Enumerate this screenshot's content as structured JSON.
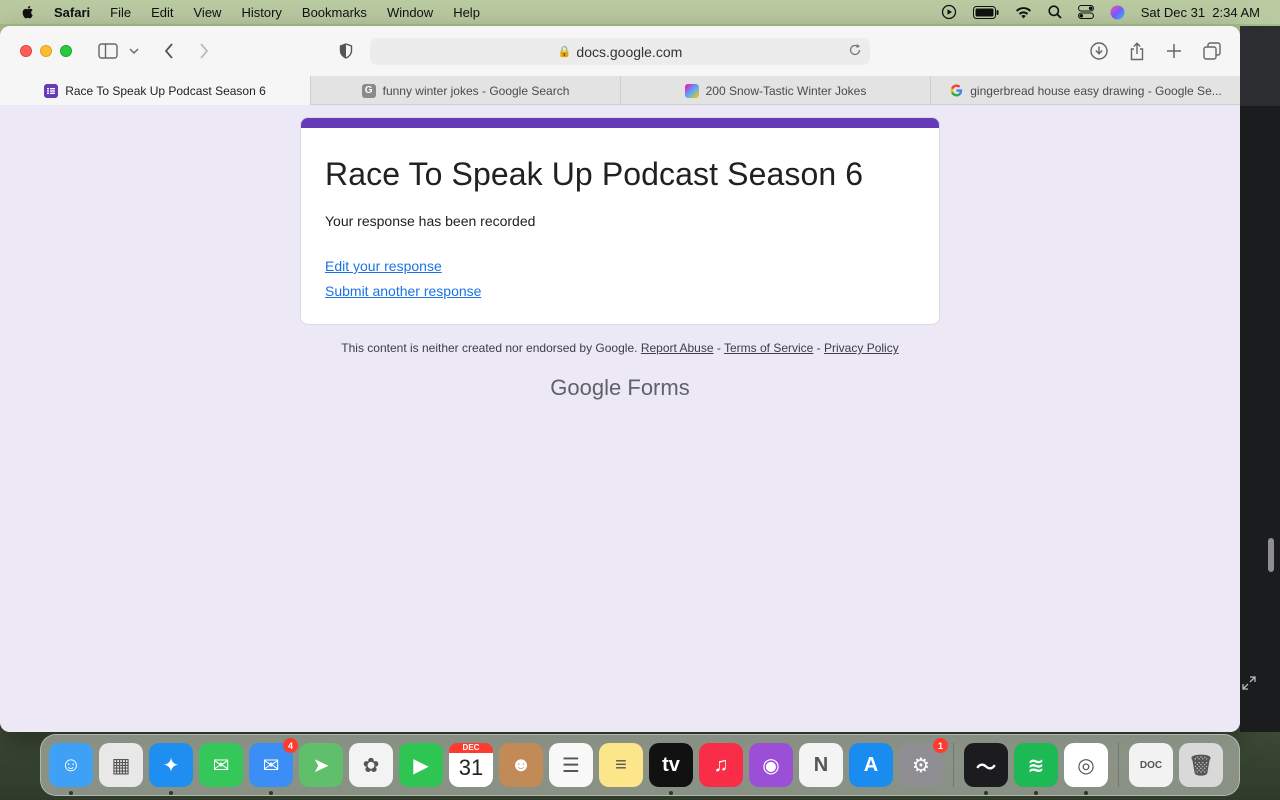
{
  "menubar": {
    "app_name": "Safari",
    "items": [
      "File",
      "Edit",
      "View",
      "History",
      "Bookmarks",
      "Window",
      "Help"
    ],
    "clock": "Sat Dec 31  2:34 AM"
  },
  "toolbar": {
    "url": "docs.google.com"
  },
  "tabs": [
    {
      "label": "Race To Speak Up Podcast Season 6",
      "favicon": "google-forms-icon",
      "active": true
    },
    {
      "label": "funny winter jokes - Google Search",
      "favicon": "google-g-icon",
      "active": false
    },
    {
      "label": "200 Snow-Tastic Winter Jokes",
      "favicon": "site-icon",
      "active": false
    },
    {
      "label": "gingerbread house easy drawing - Google Se...",
      "favicon": "google-g-icon",
      "active": false
    }
  ],
  "form": {
    "title": "Race To Speak Up Podcast Season 6",
    "message": "Your response has been recorded",
    "edit_link": "Edit your response",
    "another_link": "Submit another response",
    "accent_color": "#673ab7"
  },
  "footer": {
    "disclaimer": "This content is neither created nor endorsed by Google.",
    "report_abuse": "Report Abuse",
    "terms": "Terms of Service",
    "privacy": "Privacy Policy",
    "separator": " - ",
    "brand_google": "Google",
    "brand_forms": "Forms"
  },
  "dock": {
    "items": [
      {
        "name": "finder",
        "color": "#3ea1f5",
        "glyph": "☺",
        "running": true
      },
      {
        "name": "launchpad",
        "color": "#e8e8e8",
        "glyph": "▦",
        "running": false
      },
      {
        "name": "safari",
        "color": "#1e8ef0",
        "glyph": "✦",
        "running": true
      },
      {
        "name": "messages",
        "color": "#34c759",
        "glyph": "✉",
        "running": false
      },
      {
        "name": "mail",
        "color": "#3a8ef6",
        "glyph": "✉",
        "running": true,
        "badge": "4"
      },
      {
        "name": "maps",
        "color": "#5fbf6a",
        "glyph": "➤",
        "running": false
      },
      {
        "name": "photos",
        "color": "#f3f3f3",
        "glyph": "✿",
        "running": false
      },
      {
        "name": "facetime",
        "color": "#2fc552",
        "glyph": "▶",
        "running": false
      },
      {
        "name": "calendar",
        "color": "#ffffff",
        "glyph": "31",
        "month": "DEC",
        "running": false
      },
      {
        "name": "contacts",
        "color": "#c28a56",
        "glyph": "☻",
        "running": false
      },
      {
        "name": "reminders",
        "color": "#f8f8f8",
        "glyph": "☰",
        "running": false
      },
      {
        "name": "notes",
        "color": "#fde68a",
        "glyph": "≡",
        "running": false
      },
      {
        "name": "apple-tv",
        "color": "#111111",
        "glyph": "tv",
        "running": true
      },
      {
        "name": "music",
        "color": "#fa2d48",
        "glyph": "♫",
        "running": false
      },
      {
        "name": "podcasts",
        "color": "#9b4fd6",
        "glyph": "◉",
        "running": false
      },
      {
        "name": "news",
        "color": "#f4f4f4",
        "glyph": "N",
        "running": false
      },
      {
        "name": "app-store",
        "color": "#1a8cf0",
        "glyph": "A",
        "running": false
      },
      {
        "name": "system-preferences",
        "color": "#8e8e93",
        "glyph": "⚙",
        "running": false,
        "badge": "1"
      }
    ],
    "recent": [
      {
        "name": "activity-monitor",
        "color": "#1c1c1e",
        "glyph": "〜",
        "running": true
      },
      {
        "name": "spotify",
        "color": "#1db954",
        "glyph": "≋",
        "running": true
      },
      {
        "name": "chrome",
        "color": "#ffffff",
        "glyph": "◎",
        "running": true
      }
    ],
    "extras": [
      {
        "name": "document",
        "color": "#f2f2f2",
        "glyph": "DOC"
      },
      {
        "name": "trash",
        "color": "#d9d9d9",
        "glyph": "🗑"
      }
    ]
  }
}
